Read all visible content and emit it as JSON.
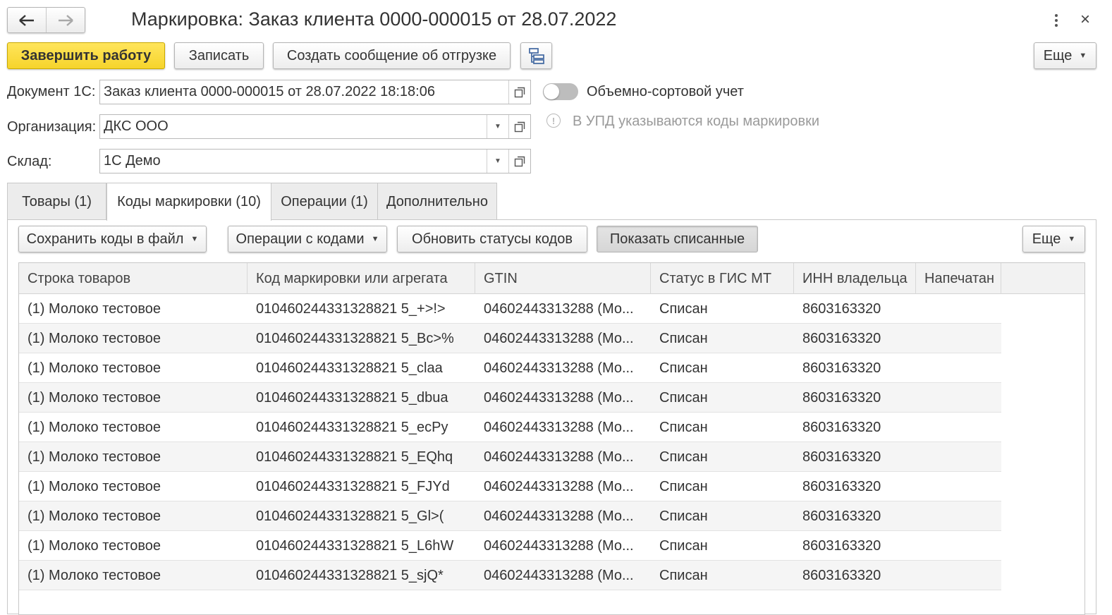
{
  "window": {
    "title": "Маркировка: Заказ клиента 0000-000015 от 28.07.2022",
    "more_icon": "kebab-icon",
    "close_label": "×"
  },
  "nav": {
    "back": "🡐",
    "forward": "🡒"
  },
  "toolbar": {
    "finish_label": "Завершить работу",
    "save_label": "Записать",
    "create_message_label": "Создать сообщение об отгрузке",
    "more_label": "Еще"
  },
  "form": {
    "document_label": "Документ 1С:",
    "document_value": "Заказ клиента 0000-000015 от 28.07.2022 18:18:06",
    "organization_label": "Организация:",
    "organization_value": "ДКС ООО",
    "warehouse_label": "Склад:",
    "warehouse_value": "1С Демо",
    "toggle_label": "Объемно-сортовой учет",
    "info_text": "В УПД указываются коды маркировки"
  },
  "tabs": [
    {
      "label": "Товары (1)"
    },
    {
      "label": "Коды маркировки (10)"
    },
    {
      "label": "Операции (1)"
    },
    {
      "label": "Дополнительно"
    }
  ],
  "codes_toolbar": {
    "save_to_file": "Сохранить коды в файл",
    "operations": "Операции с кодами",
    "refresh_status": "Обновить статусы кодов",
    "show_written_off": "Показать списанные",
    "more": "Еще"
  },
  "table": {
    "columns": [
      "Строка товаров",
      "Код маркировки или агрегата",
      "GTIN",
      "Статус в ГИС МТ",
      "ИНН владельца",
      "Напечатан"
    ],
    "rows": [
      [
        "(1) Молоко тестовое",
        "010460244331328821 5_+>!>",
        "04602443313288 (Мо...",
        "Списан",
        "8603163320",
        ""
      ],
      [
        "(1) Молоко тестовое",
        "010460244331328821 5_Bc>%",
        "04602443313288 (Мо...",
        "Списан",
        "8603163320",
        ""
      ],
      [
        "(1) Молоко тестовое",
        "010460244331328821 5_claa",
        "04602443313288 (Мо...",
        "Списан",
        "8603163320",
        ""
      ],
      [
        "(1) Молоко тестовое",
        "010460244331328821 5_dbua",
        "04602443313288 (Мо...",
        "Списан",
        "8603163320",
        ""
      ],
      [
        "(1) Молоко тестовое",
        "010460244331328821 5_ecPy",
        "04602443313288 (Мо...",
        "Списан",
        "8603163320",
        ""
      ],
      [
        "(1) Молоко тестовое",
        "010460244331328821 5_EQhq",
        "04602443313288 (Мо...",
        "Списан",
        "8603163320",
        ""
      ],
      [
        "(1) Молоко тестовое",
        "010460244331328821 5_FJYd",
        "04602443313288 (Мо...",
        "Списан",
        "8603163320",
        ""
      ],
      [
        "(1) Молоко тестовое",
        "010460244331328821 5_Gl>(",
        "04602443313288 (Мо...",
        "Списан",
        "8603163320",
        ""
      ],
      [
        "(1) Молоко тестовое",
        "010460244331328821 5_L6hW",
        "04602443313288 (Мо...",
        "Списан",
        "8603163320",
        ""
      ],
      [
        "(1) Молоко тестовое",
        "010460244331328821 5_sjQ*",
        "04602443313288 (Мо...",
        "Списан",
        "8603163320",
        ""
      ]
    ]
  },
  "colors": {
    "primary_button": "#f6d42c",
    "border": "#c8c8c8",
    "text": "#333333"
  }
}
